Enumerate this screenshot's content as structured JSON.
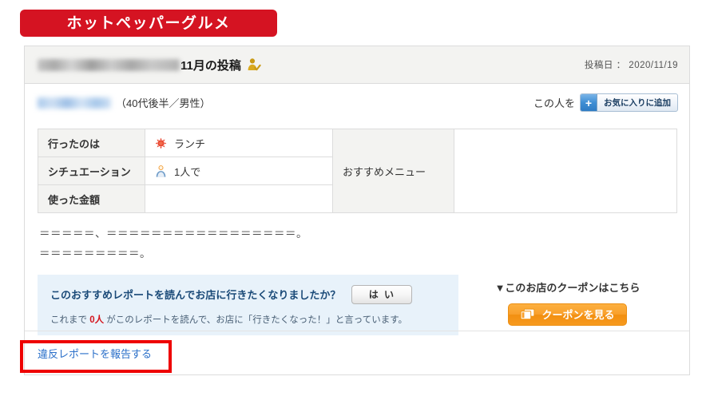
{
  "brand": {
    "banner_label": "ホットペッパーグルメ",
    "banner_color": "#d51322"
  },
  "review": {
    "header": {
      "title_redacted": true,
      "title_text": "11月の投稿",
      "verified_icon": "verified-user-icon",
      "post_date_label": "投稿日 ： 2020/11/19"
    },
    "user": {
      "name_redacted": true,
      "meta": "（40代後半／男性）",
      "favorite_prefix": "この人を",
      "favorite_plus": "+",
      "favorite_label": "お気に入りに追加"
    },
    "details": {
      "rows": [
        {
          "label": "行ったのは",
          "icon": "sun-icon",
          "value": "ランチ"
        },
        {
          "label": "シチュエーション",
          "icon": "person-icon",
          "value": "1人で"
        },
        {
          "label": "使った金額",
          "icon": "",
          "value": ""
        }
      ],
      "recommend_label": "おすすめメニュー",
      "recommend_value": ""
    },
    "body": {
      "line1": "＝＝＝＝＝、＝＝＝＝＝＝＝＝＝＝＝＝＝＝＝＝＝。",
      "line2": "＝＝＝＝＝＝＝＝＝。"
    },
    "feedback": {
      "question": "このおすすめレポートを読んでお店に行きたくなりましたか？",
      "yes_label": "は い",
      "note_prefix": "これまで ",
      "note_count": "0人",
      "note_suffix": " がこのレポートを読んで、お店に「行きたくなった！」と言っています。",
      "background_color": "#e8f2fa",
      "count_color": "#d4151e"
    },
    "coupon": {
      "heading": "▼このお店のクーポンはこちら",
      "button_icon": "ticket-icon",
      "button_label": "クーポンを見る",
      "button_color": "#f9a02c"
    },
    "report": {
      "link_label": "違反レポートを報告する",
      "link_color": "#2a6fc9"
    }
  },
  "annotation": {
    "highlight_color": "#ee0000",
    "target": "report-violation-link"
  }
}
